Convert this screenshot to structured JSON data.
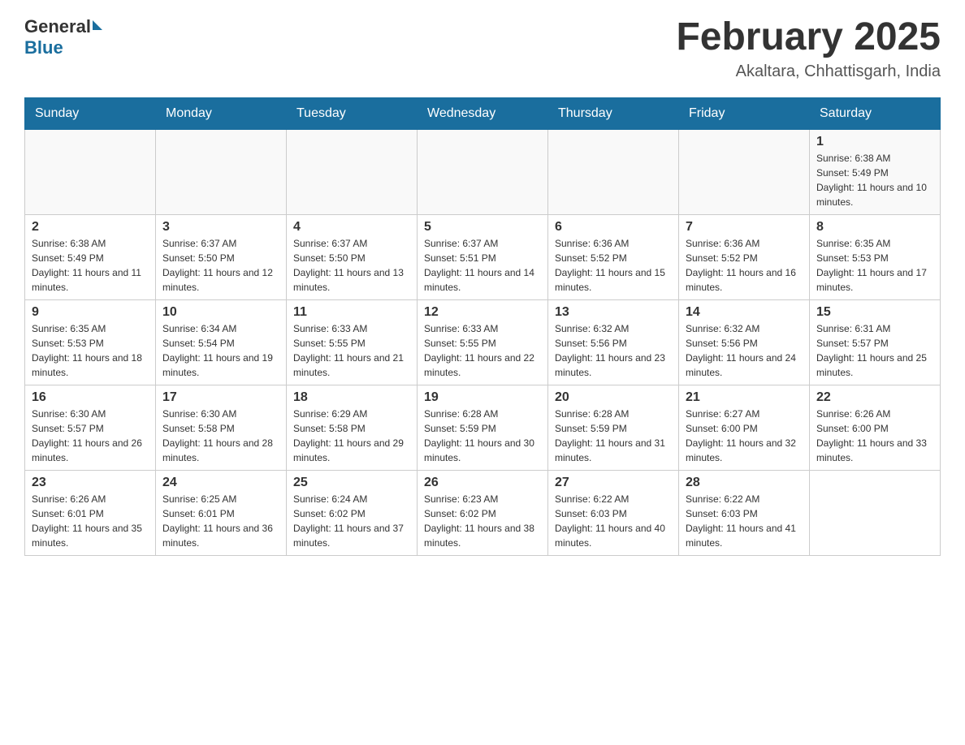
{
  "header": {
    "logo_general": "General",
    "logo_blue": "Blue",
    "month_title": "February 2025",
    "location": "Akaltara, Chhattisgarh, India"
  },
  "weekdays": [
    "Sunday",
    "Monday",
    "Tuesday",
    "Wednesday",
    "Thursday",
    "Friday",
    "Saturday"
  ],
  "weeks": [
    [
      {
        "day": "",
        "sunrise": "",
        "sunset": "",
        "daylight": ""
      },
      {
        "day": "",
        "sunrise": "",
        "sunset": "",
        "daylight": ""
      },
      {
        "day": "",
        "sunrise": "",
        "sunset": "",
        "daylight": ""
      },
      {
        "day": "",
        "sunrise": "",
        "sunset": "",
        "daylight": ""
      },
      {
        "day": "",
        "sunrise": "",
        "sunset": "",
        "daylight": ""
      },
      {
        "day": "",
        "sunrise": "",
        "sunset": "",
        "daylight": ""
      },
      {
        "day": "1",
        "sunrise": "Sunrise: 6:38 AM",
        "sunset": "Sunset: 5:49 PM",
        "daylight": "Daylight: 11 hours and 10 minutes."
      }
    ],
    [
      {
        "day": "2",
        "sunrise": "Sunrise: 6:38 AM",
        "sunset": "Sunset: 5:49 PM",
        "daylight": "Daylight: 11 hours and 11 minutes."
      },
      {
        "day": "3",
        "sunrise": "Sunrise: 6:37 AM",
        "sunset": "Sunset: 5:50 PM",
        "daylight": "Daylight: 11 hours and 12 minutes."
      },
      {
        "day": "4",
        "sunrise": "Sunrise: 6:37 AM",
        "sunset": "Sunset: 5:50 PM",
        "daylight": "Daylight: 11 hours and 13 minutes."
      },
      {
        "day": "5",
        "sunrise": "Sunrise: 6:37 AM",
        "sunset": "Sunset: 5:51 PM",
        "daylight": "Daylight: 11 hours and 14 minutes."
      },
      {
        "day": "6",
        "sunrise": "Sunrise: 6:36 AM",
        "sunset": "Sunset: 5:52 PM",
        "daylight": "Daylight: 11 hours and 15 minutes."
      },
      {
        "day": "7",
        "sunrise": "Sunrise: 6:36 AM",
        "sunset": "Sunset: 5:52 PM",
        "daylight": "Daylight: 11 hours and 16 minutes."
      },
      {
        "day": "8",
        "sunrise": "Sunrise: 6:35 AM",
        "sunset": "Sunset: 5:53 PM",
        "daylight": "Daylight: 11 hours and 17 minutes."
      }
    ],
    [
      {
        "day": "9",
        "sunrise": "Sunrise: 6:35 AM",
        "sunset": "Sunset: 5:53 PM",
        "daylight": "Daylight: 11 hours and 18 minutes."
      },
      {
        "day": "10",
        "sunrise": "Sunrise: 6:34 AM",
        "sunset": "Sunset: 5:54 PM",
        "daylight": "Daylight: 11 hours and 19 minutes."
      },
      {
        "day": "11",
        "sunrise": "Sunrise: 6:33 AM",
        "sunset": "Sunset: 5:55 PM",
        "daylight": "Daylight: 11 hours and 21 minutes."
      },
      {
        "day": "12",
        "sunrise": "Sunrise: 6:33 AM",
        "sunset": "Sunset: 5:55 PM",
        "daylight": "Daylight: 11 hours and 22 minutes."
      },
      {
        "day": "13",
        "sunrise": "Sunrise: 6:32 AM",
        "sunset": "Sunset: 5:56 PM",
        "daylight": "Daylight: 11 hours and 23 minutes."
      },
      {
        "day": "14",
        "sunrise": "Sunrise: 6:32 AM",
        "sunset": "Sunset: 5:56 PM",
        "daylight": "Daylight: 11 hours and 24 minutes."
      },
      {
        "day": "15",
        "sunrise": "Sunrise: 6:31 AM",
        "sunset": "Sunset: 5:57 PM",
        "daylight": "Daylight: 11 hours and 25 minutes."
      }
    ],
    [
      {
        "day": "16",
        "sunrise": "Sunrise: 6:30 AM",
        "sunset": "Sunset: 5:57 PM",
        "daylight": "Daylight: 11 hours and 26 minutes."
      },
      {
        "day": "17",
        "sunrise": "Sunrise: 6:30 AM",
        "sunset": "Sunset: 5:58 PM",
        "daylight": "Daylight: 11 hours and 28 minutes."
      },
      {
        "day": "18",
        "sunrise": "Sunrise: 6:29 AM",
        "sunset": "Sunset: 5:58 PM",
        "daylight": "Daylight: 11 hours and 29 minutes."
      },
      {
        "day": "19",
        "sunrise": "Sunrise: 6:28 AM",
        "sunset": "Sunset: 5:59 PM",
        "daylight": "Daylight: 11 hours and 30 minutes."
      },
      {
        "day": "20",
        "sunrise": "Sunrise: 6:28 AM",
        "sunset": "Sunset: 5:59 PM",
        "daylight": "Daylight: 11 hours and 31 minutes."
      },
      {
        "day": "21",
        "sunrise": "Sunrise: 6:27 AM",
        "sunset": "Sunset: 6:00 PM",
        "daylight": "Daylight: 11 hours and 32 minutes."
      },
      {
        "day": "22",
        "sunrise": "Sunrise: 6:26 AM",
        "sunset": "Sunset: 6:00 PM",
        "daylight": "Daylight: 11 hours and 33 minutes."
      }
    ],
    [
      {
        "day": "23",
        "sunrise": "Sunrise: 6:26 AM",
        "sunset": "Sunset: 6:01 PM",
        "daylight": "Daylight: 11 hours and 35 minutes."
      },
      {
        "day": "24",
        "sunrise": "Sunrise: 6:25 AM",
        "sunset": "Sunset: 6:01 PM",
        "daylight": "Daylight: 11 hours and 36 minutes."
      },
      {
        "day": "25",
        "sunrise": "Sunrise: 6:24 AM",
        "sunset": "Sunset: 6:02 PM",
        "daylight": "Daylight: 11 hours and 37 minutes."
      },
      {
        "day": "26",
        "sunrise": "Sunrise: 6:23 AM",
        "sunset": "Sunset: 6:02 PM",
        "daylight": "Daylight: 11 hours and 38 minutes."
      },
      {
        "day": "27",
        "sunrise": "Sunrise: 6:22 AM",
        "sunset": "Sunset: 6:03 PM",
        "daylight": "Daylight: 11 hours and 40 minutes."
      },
      {
        "day": "28",
        "sunrise": "Sunrise: 6:22 AM",
        "sunset": "Sunset: 6:03 PM",
        "daylight": "Daylight: 11 hours and 41 minutes."
      },
      {
        "day": "",
        "sunrise": "",
        "sunset": "",
        "daylight": ""
      }
    ]
  ]
}
